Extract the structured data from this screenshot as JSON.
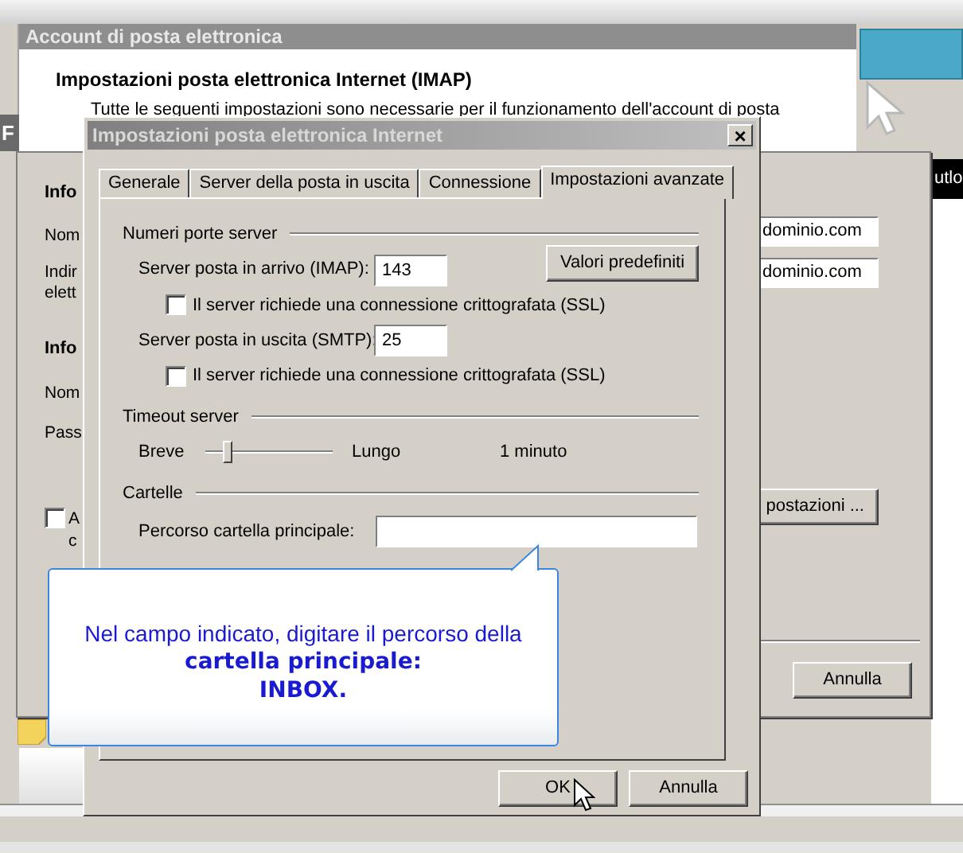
{
  "outer_window": {
    "title": "Account di posta elettronica",
    "heading": "Impostazioni posta elettronica Internet (IMAP)",
    "description": "Tutte le seguenti impostazioni sono necessarie per il funzionamento dell'account di posta"
  },
  "background_window": {
    "title_fragment": "F",
    "side_text": "utlo",
    "labels": [
      {
        "kind": "heading",
        "text": "Info"
      },
      {
        "kind": "label",
        "text": "Nom"
      },
      {
        "kind": "label",
        "text": "Indir"
      },
      {
        "kind": "label",
        "text": "elett"
      },
      {
        "kind": "heading",
        "text": "Info"
      },
      {
        "kind": "label",
        "text": "Nom"
      },
      {
        "kind": "label",
        "text": "Pass"
      }
    ],
    "checkbox": {
      "checked": false,
      "lines": [
        "A",
        "c"
      ]
    },
    "fields": [
      "dominio.com",
      "dominio.com"
    ],
    "settings_button": "postazioni ...",
    "cancel_button": "Annulla"
  },
  "dialog": {
    "title": "Impostazioni posta elettronica Internet",
    "close": "×",
    "tabs": [
      {
        "label": "Generale",
        "selected": false
      },
      {
        "label": "Server della posta in uscita",
        "selected": false
      },
      {
        "label": "Connessione",
        "selected": false
      },
      {
        "label": "Impostazioni avanzate",
        "selected": true
      }
    ],
    "ports": {
      "title": "Numeri porte server",
      "defaults_button": "Valori predefiniti",
      "servers": [
        {
          "label": "Server posta in arrivo (IMAP):",
          "value": "143",
          "ssl_label": "Il server richiede una connessione crittografata (SSL)",
          "ssl_checked": false
        },
        {
          "label": "Server posta in uscita (SMTP):",
          "value": "25",
          "ssl_label": "Il server richiede una connessione crittografata (SSL)",
          "ssl_checked": false
        }
      ]
    },
    "timeout": {
      "title": "Timeout server",
      "min_label": "Breve",
      "max_label": "Lungo",
      "level": 0.15,
      "reading": "1 minuto"
    },
    "folders": {
      "title": "Cartelle",
      "root_label": "Percorso cartella principale:"
    },
    "buttons": [
      "OK",
      "Annulla"
    ]
  },
  "callout": {
    "text": "Nel campo indicato, digitare il percorso della",
    "emphasis": [
      "cartella principale:",
      "INBOX."
    ]
  }
}
